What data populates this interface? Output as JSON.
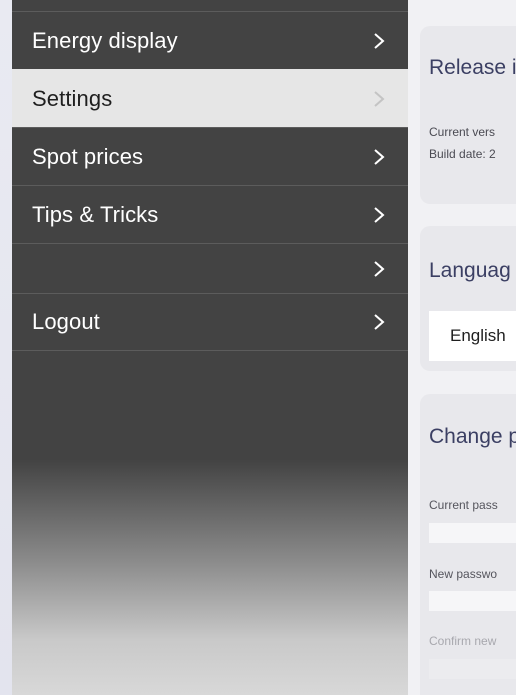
{
  "menu": {
    "items": [
      {
        "label": "Energy display",
        "active": false
      },
      {
        "label": "Settings",
        "active": true
      },
      {
        "label": "Spot prices",
        "active": false
      },
      {
        "label": "Tips & Tricks",
        "active": false
      },
      {
        "label": "",
        "active": false
      },
      {
        "label": "Logout",
        "active": false
      }
    ]
  },
  "release": {
    "title": "Release i",
    "current_version": "Current vers",
    "build_date": "Build date: 2"
  },
  "language": {
    "title": "Languag",
    "selected": "English"
  },
  "password": {
    "title": "Change p",
    "current_label": "Current pass",
    "new_label": "New passwo",
    "confirm_label": "Confirm new"
  },
  "colors": {
    "menu_bg": "#434343",
    "menu_active_bg": "#e6e6e6",
    "card_bg": "#e8e8ec",
    "title_color": "#3b3f63"
  }
}
